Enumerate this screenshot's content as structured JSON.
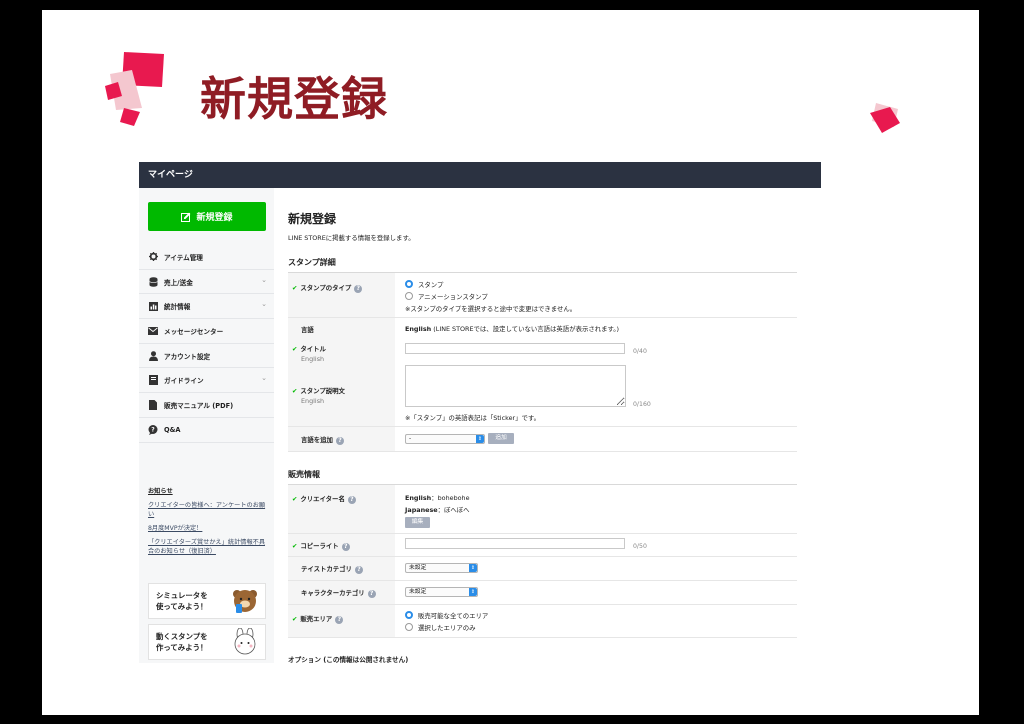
{
  "slide": {
    "title": "新規登録"
  },
  "colors": {
    "title": "#8f1c24",
    "accent": "#e8194f",
    "line_green": "#00b900",
    "topbar": "#2b3241"
  },
  "topbar": {
    "title": "マイページ"
  },
  "sidebar": {
    "new_button": {
      "label": "新規登録",
      "icon": "edit-icon"
    },
    "items": [
      {
        "label": "アイテム管理",
        "icon": "gear-icon",
        "has_chevron": false
      },
      {
        "label": "売上/送金",
        "icon": "coins-icon",
        "has_chevron": true
      },
      {
        "label": "統計情報",
        "icon": "chart-icon",
        "has_chevron": true
      },
      {
        "label": "メッセージセンター",
        "icon": "mail-icon",
        "has_chevron": false
      },
      {
        "label": "アカウント設定",
        "icon": "user-icon",
        "has_chevron": false
      },
      {
        "label": "ガイドライン",
        "icon": "book-icon",
        "has_chevron": true
      },
      {
        "label": "販売マニュアル (PDF)",
        "icon": "document-icon",
        "has_chevron": false
      },
      {
        "label": "Q&A",
        "icon": "speech-bubble-icon",
        "has_chevron": false
      }
    ],
    "notice": {
      "title": "お知らせ",
      "links": [
        "クリエイターの皆様へ：アンケートのお願い",
        "8月度MVPが決定！",
        "「クリエイターズ賞せかえ」統計情報不具合のお知らせ（復旧済）"
      ]
    },
    "banners": [
      "シミュレータを\n使ってみよう！",
      "動くスタンプを\n作ってみよう！"
    ]
  },
  "main": {
    "title": "新規登録",
    "subtitle": "LINE STOREに掲載する情報を登録します。",
    "stamp_section": {
      "title": "スタンプ詳細",
      "type_label": "スタンプのタイプ",
      "type_options": [
        "スタンプ",
        "アニメーションスタンプ"
      ],
      "type_note": "※スタンプのタイプを選択すると途中で変更はできません。",
      "lang_label": "言語",
      "lang_value": "English",
      "lang_note": " (LINE STOREでは、設定していない言語は英語が表示されます。)",
      "title_label": "タイトル",
      "title_sub": "English",
      "title_count": "0/40",
      "desc_label": "スタンプ説明文",
      "desc_sub": "English",
      "desc_count": "0/160",
      "desc_note": "※「スタンプ」の英語表記は「Sticker」です。",
      "add_lang_label": "言語を追加",
      "add_lang_select": "-",
      "add_button": "追加"
    },
    "sales_section": {
      "title": "販売情報",
      "creator_label": "クリエイター名",
      "creator_en_label": "English",
      "creator_en_value": "：bohebohe",
      "creator_ja_label": "Japanese",
      "creator_ja_value": "：ぼへぼへ",
      "edit_button": "編集",
      "copyright_label": "コピーライト",
      "copyright_count": "0/50",
      "taste_label": "テイストカテゴリ",
      "taste_value": "未設定",
      "character_label": "キャラクターカテゴリ",
      "character_value": "未設定",
      "area_label": "販売エリア",
      "area_options": [
        "販売可能な全てのエリア",
        "選択したエリアのみ"
      ]
    },
    "option_section": {
      "title": "オプション (この情報は公開されません)"
    }
  }
}
